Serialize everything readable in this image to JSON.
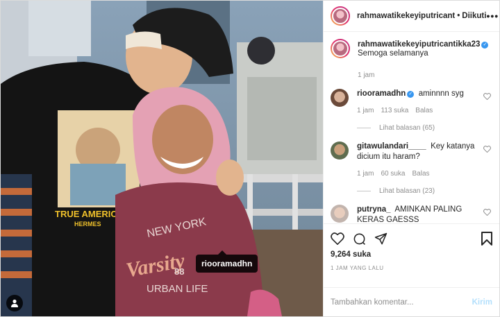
{
  "post": {
    "author": "rahmawatikekeyiputricant",
    "separator": "•",
    "follow_status": "Diikuti",
    "more": "•••"
  },
  "caption": {
    "username": "rahmawatikekeyiputricantikka23",
    "verified": true,
    "text": "Semoga selamanya",
    "time": "1 jam"
  },
  "comments": [
    {
      "username": "riooramadhn",
      "verified": true,
      "text": "aminnnn syg",
      "time": "1 jam",
      "likes": "113 suka",
      "reply": "Balas",
      "view_replies": "Lihat balasan (65)"
    },
    {
      "username": "gitawulandari____",
      "verified": false,
      "text": "Key katanya dicium itu haram?",
      "time": "1 jam",
      "likes": "60 suka",
      "reply": "Balas",
      "view_replies": "Lihat balasan (23)"
    },
    {
      "username": "putryna_",
      "verified": false,
      "text": "AMINKAN PALING KERAS GAESSS"
    }
  ],
  "stats": {
    "likes": "9,264 suka",
    "posted_ago": "1 JAM YANG LALU"
  },
  "composer": {
    "placeholder": "Tambahkan komentar...",
    "post_label": "Kirim"
  },
  "photo": {
    "tag_label": "riooramadhn",
    "shirt_text_left": "TRUE AMERIC",
    "shirt_text_left2": "HERMES",
    "shirt_text_right1": "NEW YORK",
    "shirt_text_right2": "Varsity",
    "shirt_text_right3": "88",
    "shirt_text_right4": "URBAN LIFE"
  },
  "colors": {
    "link_blue": "#3897f0",
    "post_disabled": "#b2dffc",
    "muted": "#8e8e8e"
  }
}
